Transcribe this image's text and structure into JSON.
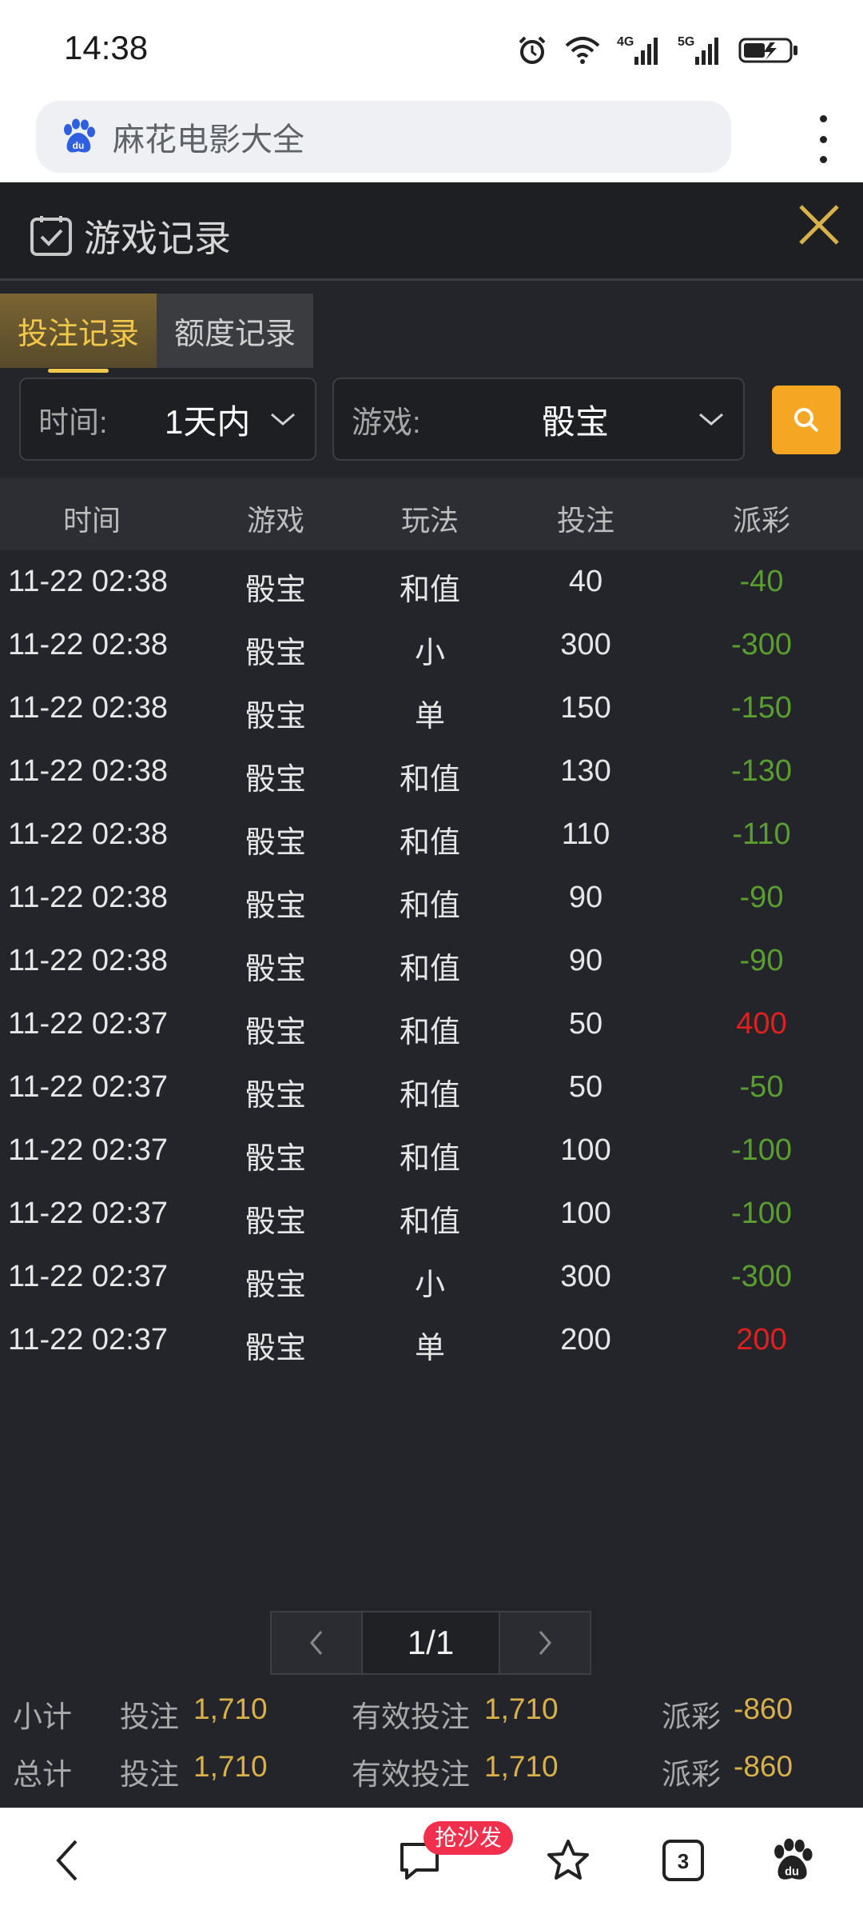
{
  "status_bar": {
    "time": "14:38",
    "icons": [
      "alarm-icon",
      "wifi-icon",
      "4g-signal-icon",
      "5g-signal-icon",
      "battery-icon"
    ],
    "network_4g": "4G",
    "network_5g": "5G"
  },
  "browser": {
    "address_text": "麻花电影大全",
    "logo": "baidu-paw-icon",
    "logo_text": "du"
  },
  "app": {
    "title": "游戏记录",
    "tabs": [
      {
        "label": "投注记录",
        "active": true
      },
      {
        "label": "额度记录",
        "active": false
      }
    ],
    "filters": {
      "time_label": "时间:",
      "time_value": "1天内",
      "game_label": "游戏:",
      "game_value": "骰宝"
    },
    "columns": [
      "时间",
      "游戏",
      "玩法",
      "投注",
      "派彩"
    ],
    "rows": [
      {
        "time": "11-22 02:38",
        "game": "骰宝",
        "play": "和值",
        "bet": "40",
        "payout": "-40",
        "sign": "neg"
      },
      {
        "time": "11-22 02:38",
        "game": "骰宝",
        "play": "小",
        "bet": "300",
        "payout": "-300",
        "sign": "neg"
      },
      {
        "time": "11-22 02:38",
        "game": "骰宝",
        "play": "单",
        "bet": "150",
        "payout": "-150",
        "sign": "neg"
      },
      {
        "time": "11-22 02:38",
        "game": "骰宝",
        "play": "和值",
        "bet": "130",
        "payout": "-130",
        "sign": "neg"
      },
      {
        "time": "11-22 02:38",
        "game": "骰宝",
        "play": "和值",
        "bet": "110",
        "payout": "-110",
        "sign": "neg"
      },
      {
        "time": "11-22 02:38",
        "game": "骰宝",
        "play": "和值",
        "bet": "90",
        "payout": "-90",
        "sign": "neg"
      },
      {
        "time": "11-22 02:38",
        "game": "骰宝",
        "play": "和值",
        "bet": "90",
        "payout": "-90",
        "sign": "neg"
      },
      {
        "time": "11-22 02:37",
        "game": "骰宝",
        "play": "和值",
        "bet": "50",
        "payout": "400",
        "sign": "pos"
      },
      {
        "time": "11-22 02:37",
        "game": "骰宝",
        "play": "和值",
        "bet": "50",
        "payout": "-50",
        "sign": "neg"
      },
      {
        "time": "11-22 02:37",
        "game": "骰宝",
        "play": "和值",
        "bet": "100",
        "payout": "-100",
        "sign": "neg"
      },
      {
        "time": "11-22 02:37",
        "game": "骰宝",
        "play": "和值",
        "bet": "100",
        "payout": "-100",
        "sign": "neg"
      },
      {
        "time": "11-22 02:37",
        "game": "骰宝",
        "play": "小",
        "bet": "300",
        "payout": "-300",
        "sign": "neg"
      },
      {
        "time": "11-22 02:37",
        "game": "骰宝",
        "play": "单",
        "bet": "200",
        "payout": "200",
        "sign": "pos"
      }
    ],
    "pagination": {
      "page_text": "1/1"
    },
    "subtotal": {
      "label": "小计",
      "bet_label": "投注",
      "bet_value": "1,710",
      "valid_label": "有效投注",
      "valid_value": "1,710",
      "payout_label": "派彩",
      "payout_value": "-860"
    },
    "total": {
      "label": "总计",
      "bet_label": "投注",
      "bet_value": "1,710",
      "valid_label": "有效投注",
      "valid_value": "1,710",
      "payout_label": "派彩",
      "payout_value": "-860"
    },
    "colors": {
      "accent": "#f2c84b",
      "search": "#f5a623",
      "loss": "#5a9e2f",
      "win": "#e0201e",
      "background": "#23252a"
    }
  },
  "bottom_nav": {
    "sofa_badge": "抢沙发",
    "tab_count": "3",
    "icons": [
      "back-icon",
      "comment-icon",
      "star-icon",
      "tabs-icon",
      "baidu-paw-icon"
    ]
  }
}
